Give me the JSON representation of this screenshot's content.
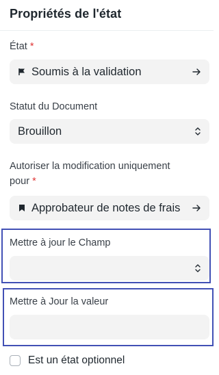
{
  "panel": {
    "title": "Propriétés de l'état"
  },
  "fields": {
    "state": {
      "label": "État",
      "required_mark": "*",
      "value": "Soumis à la validation",
      "lead_icon": "flag-icon",
      "trail_icon": "arrow-right-icon"
    },
    "doc_status": {
      "label": "Statut du Document",
      "value": "Brouillon",
      "trail_icon": "select-updown-icon"
    },
    "allow_edit": {
      "label_line1": "Autoriser la modification uniquement",
      "label_line2": "pour",
      "required_mark": "*",
      "value": "Approbateur de notes de frais",
      "lead_icon": "bookmark-icon",
      "trail_icon": "arrow-right-icon"
    },
    "update_field": {
      "label": "Mettre à jour le Champ",
      "value": "",
      "trail_icon": "select-updown-icon"
    },
    "update_value": {
      "label": "Mettre à Jour la valeur",
      "value": ""
    },
    "optional_state": {
      "label": "Est un état optionnel",
      "checked": false
    }
  },
  "colors": {
    "highlight_border": "#4150b5",
    "required": "#e03636",
    "input_bg": "#f3f3f3"
  }
}
